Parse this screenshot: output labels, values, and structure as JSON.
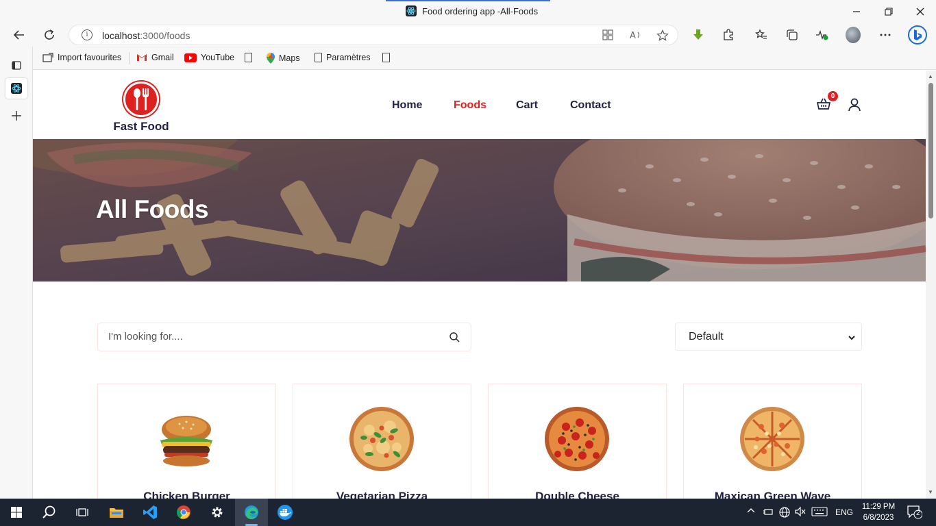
{
  "browser": {
    "tab_title": "Food ordering app -All-Foods",
    "url_host": "localhost",
    "url_path": ":3000/foods",
    "bookmarks": [
      {
        "label": "Import favourites"
      },
      {
        "label": "Gmail"
      },
      {
        "label": "YouTube"
      },
      {
        "label": ""
      },
      {
        "label": "Maps"
      },
      {
        "label": "Paramètres"
      },
      {
        "label": ""
      }
    ]
  },
  "site": {
    "brand": "Fast Food",
    "nav": [
      "Home",
      "Foods",
      "Cart",
      "Contact"
    ],
    "active_nav": "Foods",
    "cart_count": "0",
    "accent_color": "#df2020",
    "text_color": "#212245"
  },
  "hero": {
    "title": "All Foods"
  },
  "search": {
    "placeholder": "I'm looking for...."
  },
  "sort": {
    "selected": "Default"
  },
  "products": [
    {
      "name": "Chicken Burger"
    },
    {
      "name": "Vegetarian Pizza"
    },
    {
      "name": "Double Cheese"
    },
    {
      "name": "Maxican Green Wave"
    }
  ],
  "taskbar": {
    "lang": "ENG",
    "time": "11:29 PM",
    "date": "6/8/2023",
    "notifications": "2"
  }
}
